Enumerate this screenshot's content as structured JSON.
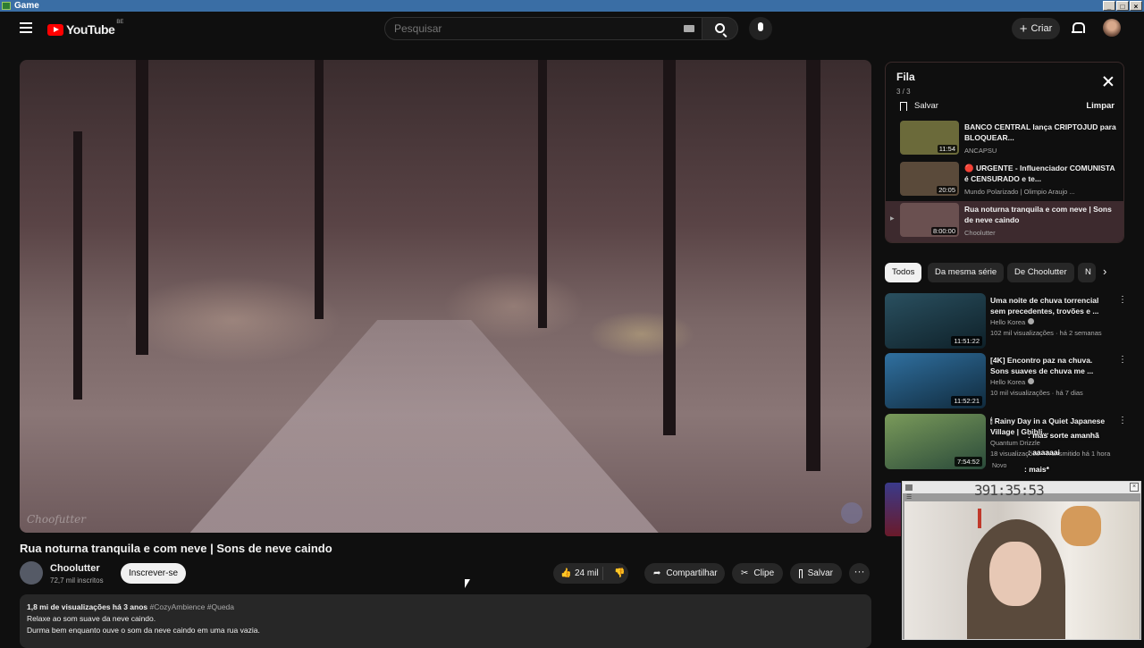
{
  "window": {
    "title": "Game"
  },
  "header": {
    "logo_text": "YouTube",
    "logo_region": "BE",
    "search_placeholder": "Pesquisar",
    "create_label": "Criar"
  },
  "video": {
    "title": "Rua noturna tranquila e com neve | Sons de neve caindo",
    "watermark": "Choofutter",
    "channel": {
      "name": "Choolutter",
      "subscribers": "72,7 mil inscritos"
    },
    "subscribe_label": "Inscrever-se",
    "likes": "24 mil",
    "share_label": "Compartilhar",
    "clip_label": "Clipe",
    "save_label": "Salvar",
    "description": {
      "meta": "1,8 mi de visualizações  há 3 anos",
      "tags": "#CozyAmbience #Queda",
      "line1": "Relaxe ao som suave da neve caindo.",
      "line2": "Durma bem enquanto ouve o som da neve caindo em uma rua vazia."
    }
  },
  "queue": {
    "title": "Fila",
    "count": "3 / 3",
    "save_label": "Salvar",
    "clear_label": "Limpar",
    "items": [
      {
        "title": "BANCO CENTRAL lança CRIPTOJUD para BLOQUEAR...",
        "channel": "ANCAPSU",
        "duration": "11:54",
        "thumb_color": "#6b6a3a"
      },
      {
        "title": "🔴 URGENTE - Influenciador COMUNISTA é CENSURADO e te...",
        "channel": "Mundo Polarizado | Olimpio Araujo ...",
        "duration": "20:05",
        "thumb_color": "#5a4a3a"
      },
      {
        "title": "Rua noturna tranquila e com neve | Sons de neve caindo",
        "channel": "Choolutter",
        "duration": "8:00:00",
        "thumb_color": "#6a5050"
      }
    ]
  },
  "chips": [
    "Todos",
    "Da mesma série",
    "De Choolutter",
    "N"
  ],
  "recommendations": [
    {
      "title": "Uma noite de chuva torrencial sem precedentes, trovões e ...",
      "channel": "Hello Korea",
      "meta": "102 mil visualizações · há 2 semanas",
      "duration": "11:51:22",
      "thumb_color": "#1d3a46"
    },
    {
      "title": "[4K] Encontro paz na chuva. Sons suaves de chuva me ...",
      "channel": "Hello Korea",
      "meta": "10 mil visualizações · há 7 dias",
      "duration": "11:52:21",
      "thumb_color": "#1f4a66"
    },
    {
      "title": "🕯 Rainy Day in a Quiet Japanese Village | Ghibli...",
      "channel": "Quantum Drizzle",
      "meta": "18 visualizações · Transmitido há 1 hora",
      "duration": "7:54:52",
      "thumb_color": "#4a6a3a"
    }
  ],
  "chat_overlay": [
    {
      "text": ": mas sorte amanhã"
    },
    {
      "text": ": aaaaaai"
    },
    {
      "text": "Novo"
    },
    {
      "text": ": mais*"
    }
  ],
  "webcam": {
    "timer": "391:35:53"
  }
}
